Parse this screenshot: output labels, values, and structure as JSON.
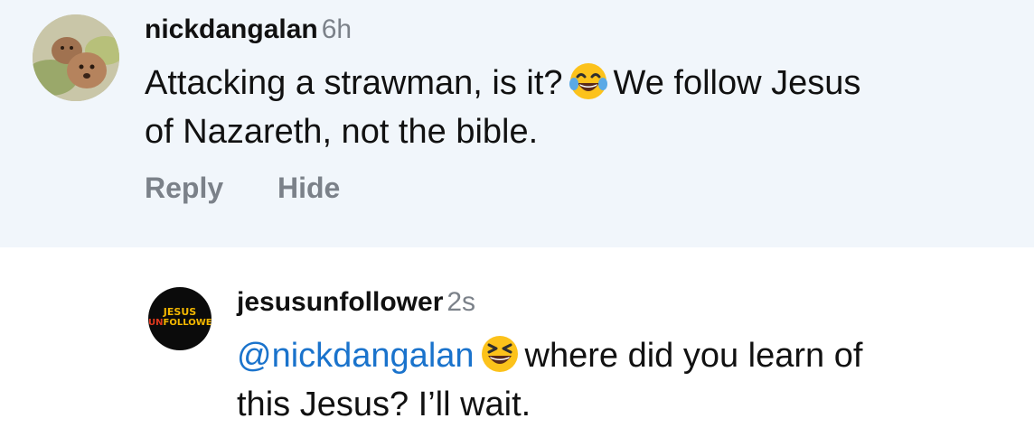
{
  "comments": [
    {
      "username": "nickdangalan",
      "time": "6h",
      "line1_before": "Attacking a strawman, is it?",
      "line1_after": "We follow Jesus",
      "line2": "of Nazareth, not the bible.",
      "emoji_icon": "face-with-tears-of-joy-emoji",
      "actions": {
        "reply": "Reply",
        "hide": "Hide"
      }
    },
    {
      "username": "jesusunfollower",
      "time": "2s",
      "mention": "@nickdangalan",
      "line1_after": "where did you learn of",
      "line2": "this Jesus? I’ll wait.",
      "emoji_icon": "grinning-squinting-face-emoji",
      "avatar_logo": {
        "line1": "JESUS",
        "line2_u": "UN",
        "line2_rest": "FOLLOWER"
      }
    }
  ],
  "colors": {
    "highlight_bg": "#f1f6fb",
    "mention": "#1a73cc",
    "muted": "#7b8189",
    "emoji_yellow": "#fcc21b",
    "logo_yellow": "#f5b800",
    "logo_red": "#e23a1e"
  }
}
